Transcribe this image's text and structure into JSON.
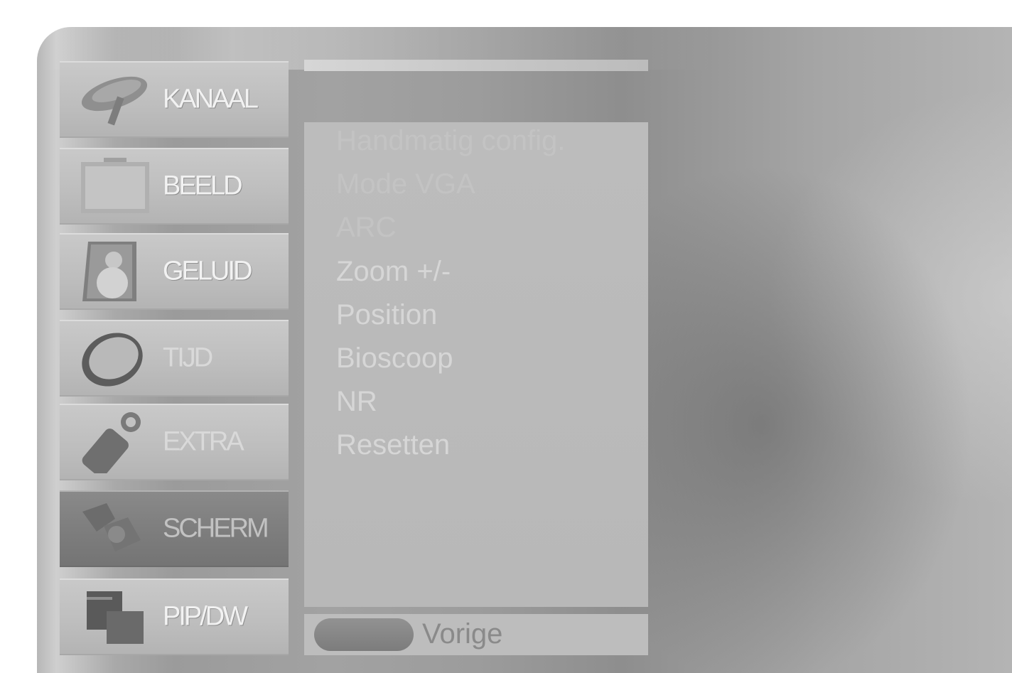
{
  "menu": {
    "tabs": [
      {
        "id": "kanaal",
        "label": "KANAAL",
        "icon": "satellite-dish-icon"
      },
      {
        "id": "beeld",
        "label": "BEELD",
        "icon": "picture-screen-icon"
      },
      {
        "id": "geluid",
        "label": "GELUID",
        "icon": "speaker-icon"
      },
      {
        "id": "tijd",
        "label": "TIJD",
        "icon": "clock-icon"
      },
      {
        "id": "extra",
        "label": "EXTRA",
        "icon": "tag-icon"
      },
      {
        "id": "scherm",
        "label": "SCHERM",
        "icon": "screen-settings-icon",
        "active": true
      },
      {
        "id": "pipdw",
        "label": "PIP/DW",
        "icon": "pip-windows-icon"
      }
    ]
  },
  "submenu": {
    "items": [
      "Handmatig config.",
      "Mode VGA",
      "ARC",
      "Zoom +/-",
      "Position",
      "Bioscoop",
      "NR",
      "Resetten"
    ]
  },
  "footer": {
    "back_label": "Vorige",
    "back_button_icon": "menu-oval-button-icon"
  },
  "colors": {
    "panel_light": "#c9c9c9",
    "panel_active": "#7e7e7e",
    "text_light": "#f2f2f2",
    "content_bg": "#bcbcbc"
  }
}
